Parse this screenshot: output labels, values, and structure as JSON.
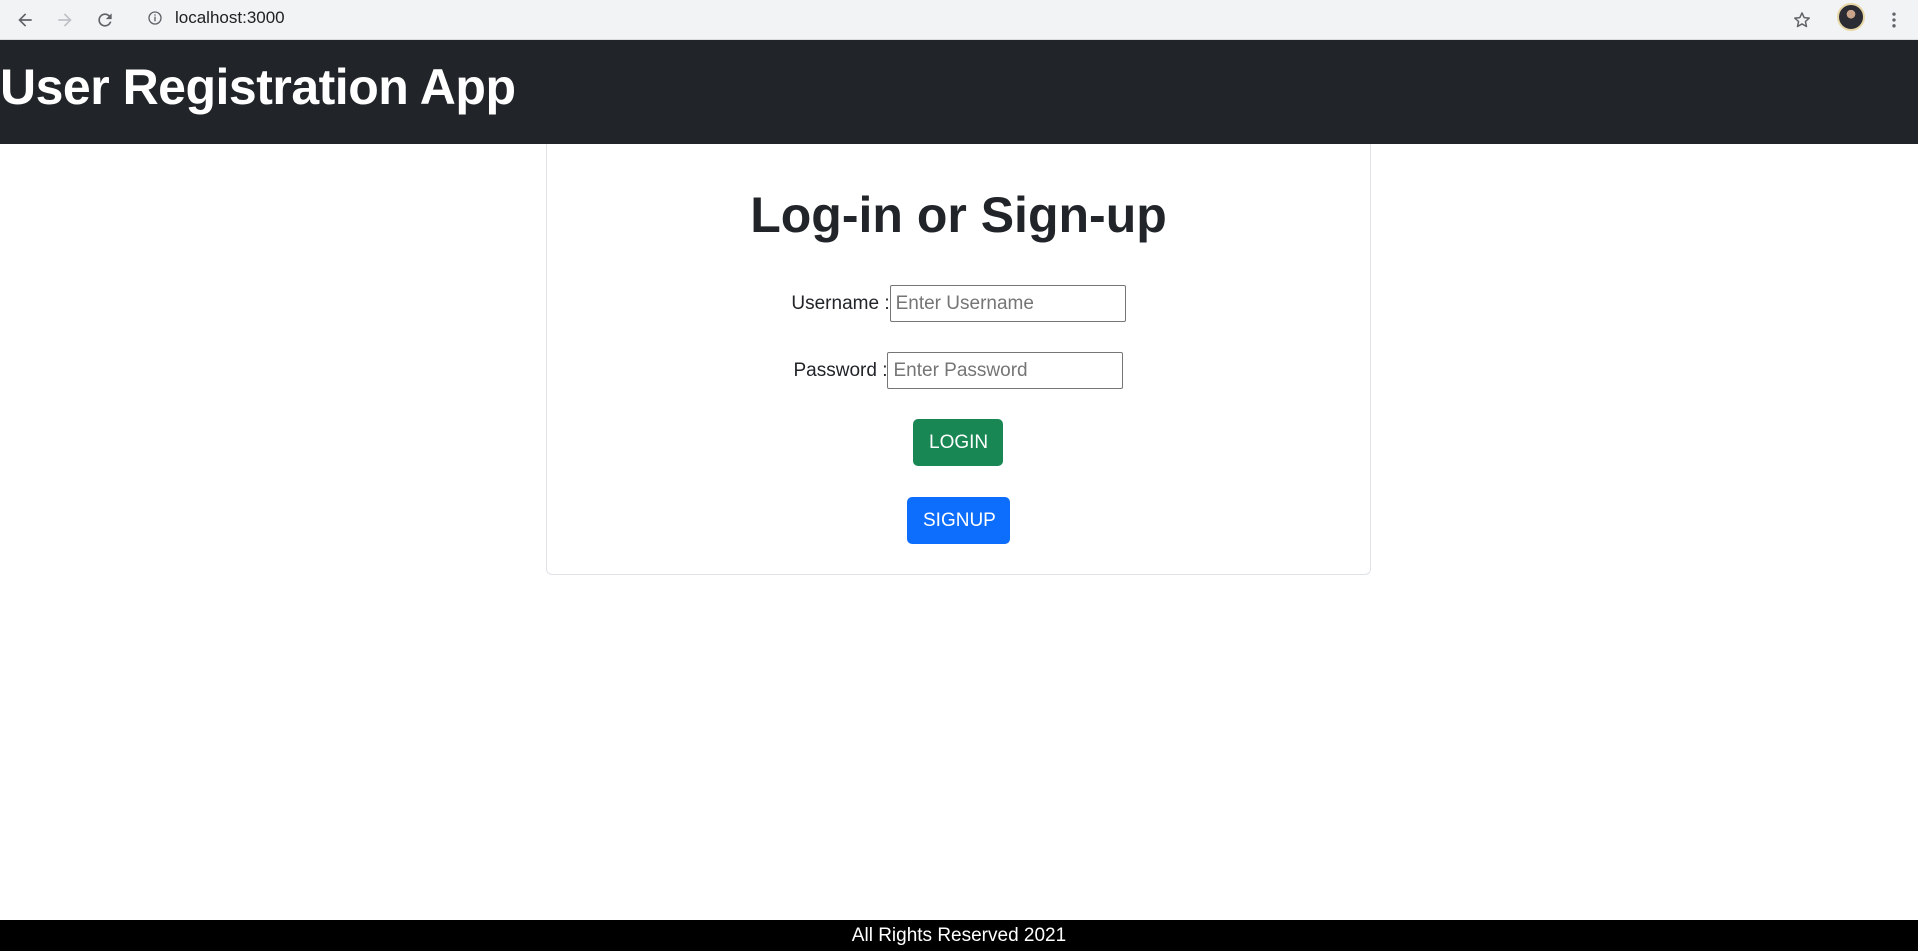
{
  "browser": {
    "url": "localhost:3000",
    "icons": [
      "back-arrow-icon",
      "forward-arrow-icon",
      "reload-icon",
      "info-icon",
      "star-icon",
      "avatar",
      "more-vert-icon"
    ]
  },
  "header": {
    "title": "User Registration App"
  },
  "card": {
    "title": "Log-in or Sign-up",
    "username": {
      "label": "Username :",
      "placeholder": "Enter Username"
    },
    "password": {
      "label": "Password :",
      "placeholder": "Enter Password"
    },
    "login_label": "LOGIN",
    "signup_label": "SIGNUP"
  },
  "footer": {
    "text": "All Rights Reserved 2021"
  },
  "colors": {
    "header_bg": "#212529",
    "login_button": "#198754",
    "signup_button": "#0d6efd",
    "footer_bg": "#000000"
  }
}
